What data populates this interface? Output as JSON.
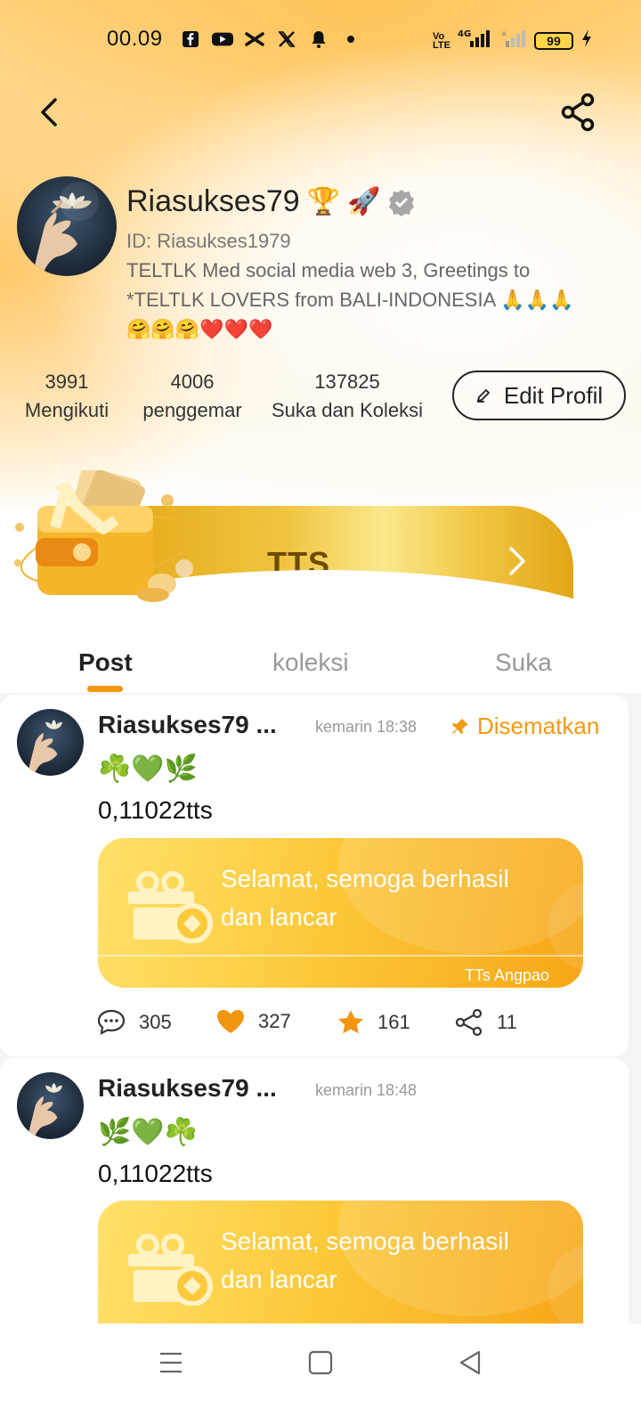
{
  "status_bar": {
    "time": "00.09",
    "battery": "99",
    "icons": [
      "facebook-icon",
      "youtube-icon",
      "capcut-icon",
      "x-icon",
      "notification-bell-icon",
      "dot-icon",
      "volte-icon",
      "4g-signal-icon",
      "signal-icon",
      "charging-icon"
    ]
  },
  "profile": {
    "username": "Riasukses79",
    "badges": [
      "🏆",
      "🚀"
    ],
    "user_id": "ID: Riasukses1979",
    "bio_line1": "TELTLK Med social media web 3, Greetings to",
    "bio_line2": "*TELTLK LOVERS from BALI-INDONESIA 🙏🙏🙏",
    "bio_line3": "🤗🤗🤗❤️❤️❤️",
    "stats": [
      {
        "value": "3991",
        "label": "Mengikuti"
      },
      {
        "value": "4006",
        "label": "penggemar"
      },
      {
        "value": "137825",
        "label": "Suka dan Koleksi"
      }
    ],
    "edit_label": "Edit Profil"
  },
  "banner": {
    "label": "TTS"
  },
  "tabs": [
    {
      "label": "Post",
      "active": true
    },
    {
      "label": "koleksi",
      "active": false
    },
    {
      "label": "Suka",
      "active": false
    }
  ],
  "posts": [
    {
      "author": "Riasukses79 ...",
      "time": "kemarin 18:38",
      "pinned_label": "Disematkan",
      "emoji": "☘️💚🌿",
      "amount": "0,11022tts",
      "angpao_line1": "Selamat, semoga berhasil",
      "angpao_line2": "dan lancar",
      "angpao_footer": "TTs Angpao",
      "comments": "305",
      "likes": "327",
      "stars": "161",
      "shares": "11"
    },
    {
      "author": "Riasukses79 ...",
      "time": "kemarin 18:48",
      "emoji": "🌿💚☘️",
      "amount": "0,11022tts",
      "angpao_line1": "Selamat, semoga berhasil",
      "angpao_line2": "dan lancar"
    }
  ],
  "colors": {
    "accent": "#f29611",
    "banner_gold": "#f0c542",
    "angpao_start": "#ffe16a",
    "angpao_end": "#f6a616"
  }
}
